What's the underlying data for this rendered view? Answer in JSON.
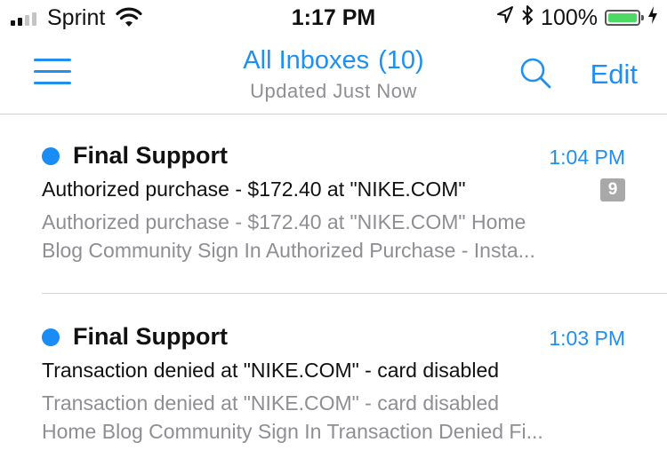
{
  "colors": {
    "accent": "#1f8ff0",
    "unread_dot": "#1a8cf5",
    "battery_green": "#4cd964",
    "signal_dark": "#111111",
    "signal_light": "#c4c4c4"
  },
  "status_bar": {
    "carrier": "Sprint",
    "time": "1:17 PM",
    "battery_percent": "100%",
    "battery_level": 1.0,
    "signal_bars_filled": 2,
    "signal_bars_total": 4,
    "icons": [
      "signal-icon",
      "wifi-icon",
      "location-icon",
      "bluetooth-icon",
      "battery-icon",
      "charging-icon"
    ]
  },
  "nav": {
    "title": "All Inboxes",
    "count": "(10)",
    "subtitle": "Updated Just Now",
    "edit_label": "Edit",
    "icons": [
      "menu-icon",
      "search-icon"
    ]
  },
  "messages": [
    {
      "sender": "Final Support",
      "time": "1:04 PM",
      "subject": "Authorized purchase - $172.40 at \"NIKE.COM\"",
      "thread_count": "9",
      "preview_line1": "Authorized purchase - $172.40 at \"NIKE.COM\" Home",
      "preview_line2": "Blog Community Sign In Authorized Purchase - Insta...",
      "unread": true
    },
    {
      "sender": "Final Support",
      "time": "1:03 PM",
      "subject": "Transaction denied at \"NIKE.COM\" - card disabled",
      "preview_line1": "Transaction denied at \"NIKE.COM\" - card disabled",
      "preview_line2": "Home Blog Community Sign In Transaction Denied Fi...",
      "unread": true
    }
  ]
}
